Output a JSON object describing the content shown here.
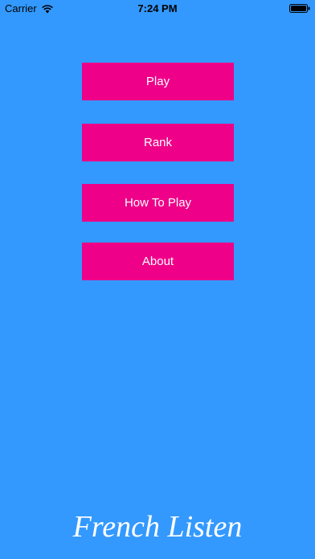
{
  "status_bar": {
    "carrier": "Carrier",
    "time": "7:24 PM",
    "wifi_icon": "wifi-icon",
    "battery_icon": "battery-icon"
  },
  "menu": {
    "items": [
      {
        "label": "Play"
      },
      {
        "label": "Rank"
      },
      {
        "label": "How To Play"
      },
      {
        "label": "About"
      }
    ]
  },
  "footer": {
    "title": "French Listen"
  },
  "colors": {
    "background": "#3399ff",
    "button": "#ee0088",
    "text": "#ffffff"
  }
}
